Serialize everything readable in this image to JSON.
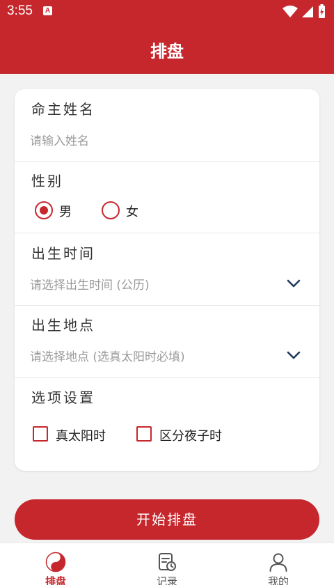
{
  "status_bar": {
    "time": "3:55",
    "badge": "A"
  },
  "header": {
    "title": "排盘"
  },
  "form": {
    "name": {
      "label": "命主姓名",
      "placeholder": "请输入姓名"
    },
    "gender": {
      "label": "性别",
      "options": [
        "男",
        "女"
      ],
      "selected": "男"
    },
    "birth_time": {
      "label": "出生时间",
      "placeholder": "请选择出生时间 (公历)"
    },
    "birth_place": {
      "label": "出生地点",
      "placeholder": "请选择地点 (选真太阳时必填)"
    },
    "options": {
      "label": "选项设置",
      "items": [
        {
          "label": "真太阳时",
          "checked": false
        },
        {
          "label": "区分夜子时",
          "checked": false
        }
      ]
    }
  },
  "start_button": {
    "label": "开始排盘"
  },
  "bottom_nav": {
    "active": "排盘",
    "items": [
      {
        "label": "排盘",
        "icon": "yin-yang-icon"
      },
      {
        "label": "记录",
        "icon": "record-icon"
      },
      {
        "label": "我的",
        "icon": "user-icon"
      }
    ]
  },
  "colors": {
    "primary": "#c6272d",
    "background": "#f2f2f2"
  }
}
